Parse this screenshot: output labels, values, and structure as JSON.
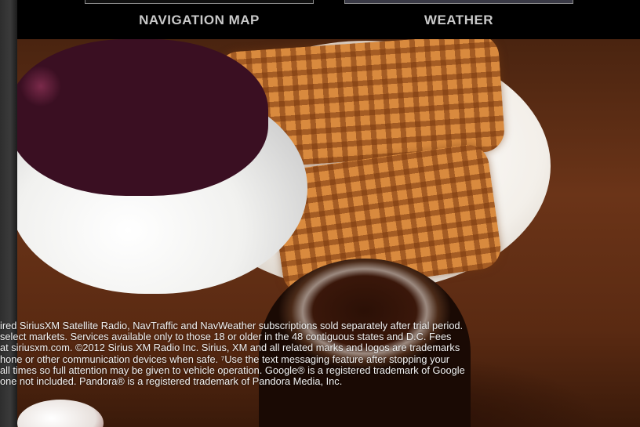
{
  "carousel": {
    "items": [
      {
        "label": "NAVIGATION MAP"
      },
      {
        "label": "WEATHER"
      }
    ]
  },
  "disclaimer": {
    "lines": [
      "ired SiriusXM Satellite Radio, NavTraffic and NavWeather subscriptions sold separately after trial period.",
      "select markets. Services available only to those 18 or older in the 48 contiguous states and D.C. Fees",
      "at siriusxm.com. ©2012 Sirius XM Radio Inc. Sirius, XM and all related marks and logos are trademarks",
      "hone or other communication devices when safe. ⁷Use the text messaging feature after stopping your",
      "all times so full attention may be given to vehicle operation. Google® is a registered trademark of Google",
      "one not included. Pandora® is a registered trademark of Pandora Media, Inc."
    ]
  },
  "colors": {
    "band_background": "#000000",
    "label_text": "#c9c9c9",
    "disclaimer_text": "#f2f2f2"
  }
}
